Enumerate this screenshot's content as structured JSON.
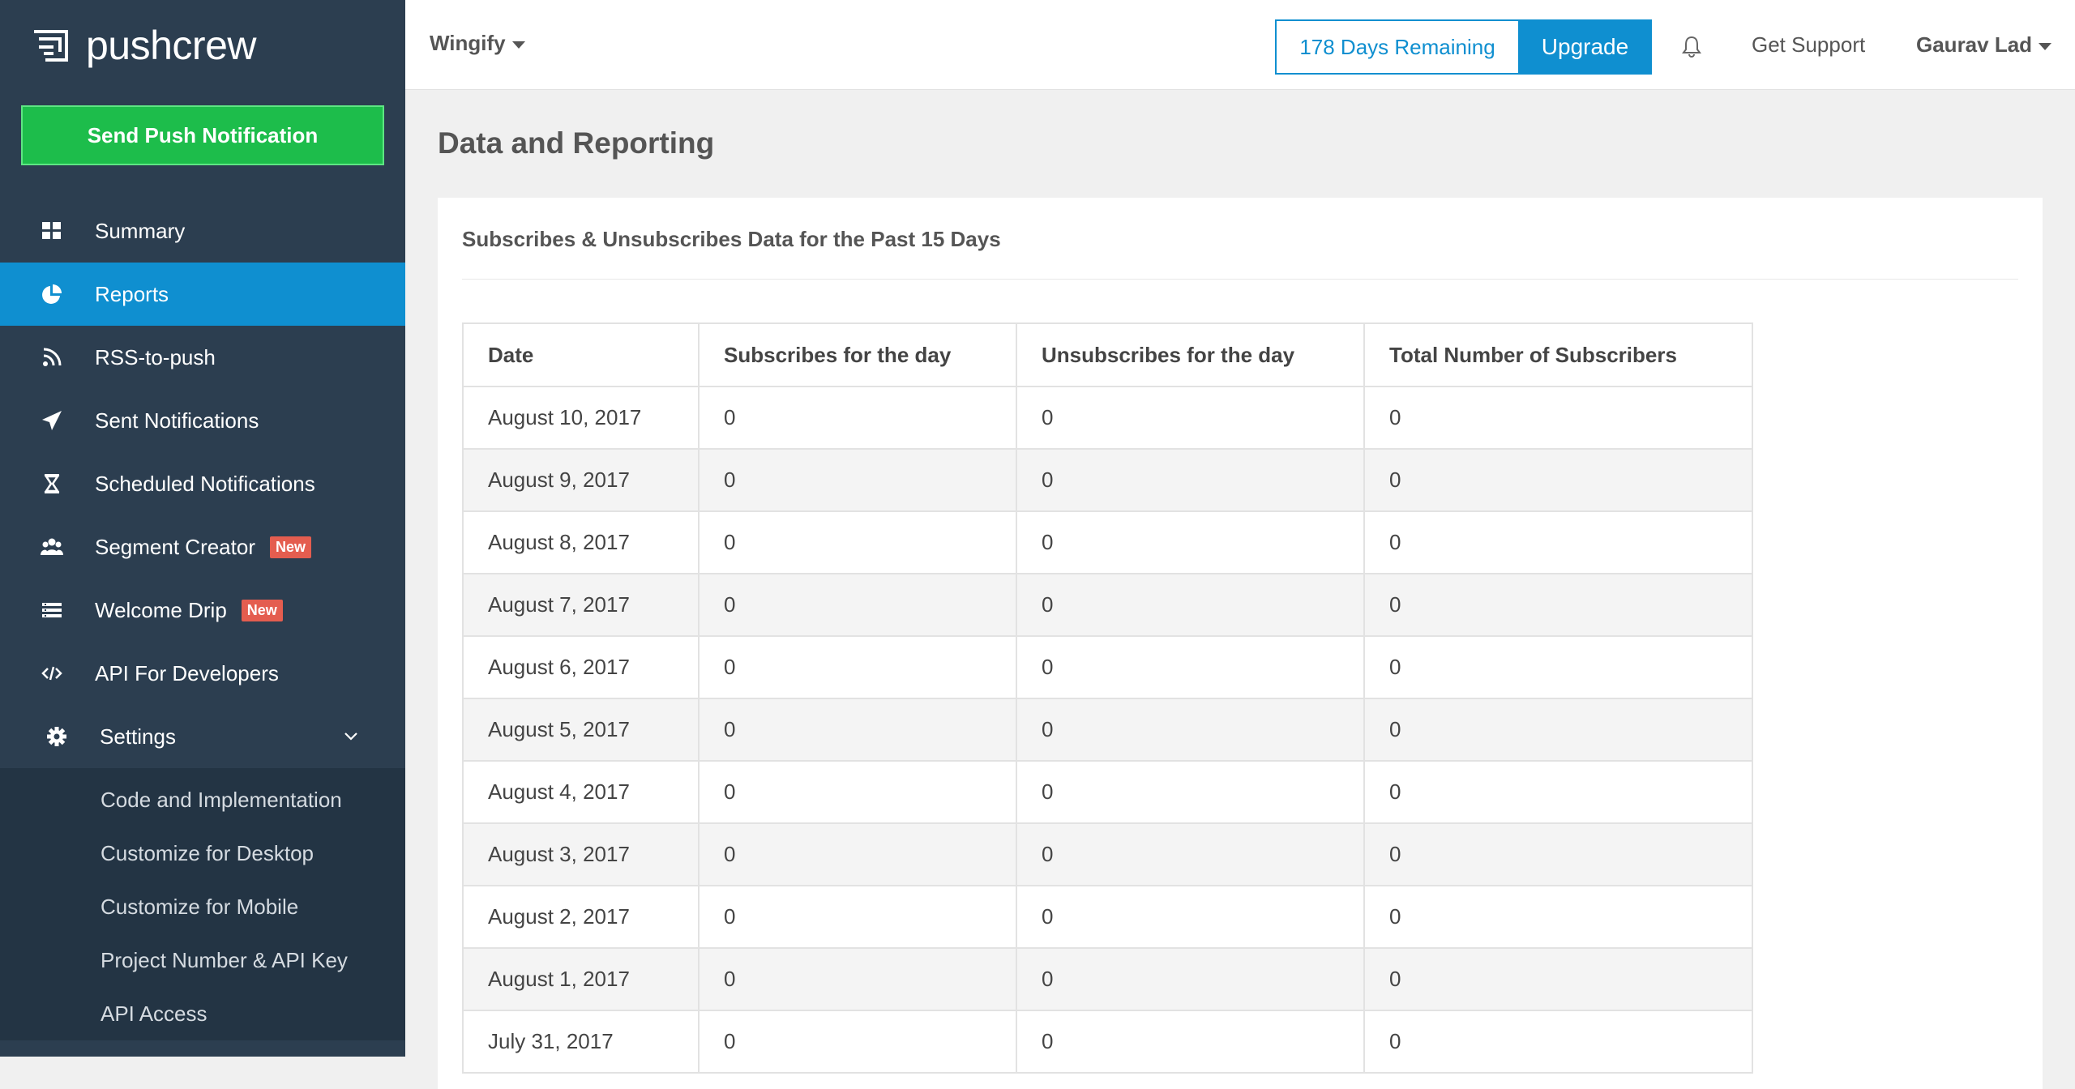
{
  "brand": {
    "name": "pushcrew"
  },
  "sidebar": {
    "send_button": "Send Push Notification",
    "items": [
      {
        "label": "Summary",
        "icon": "dashboard-icon",
        "active": false
      },
      {
        "label": "Reports",
        "icon": "pie-chart-icon",
        "active": true
      },
      {
        "label": "RSS-to-push",
        "icon": "rss-icon",
        "active": false
      },
      {
        "label": "Sent Notifications",
        "icon": "paper-plane-icon",
        "active": false
      },
      {
        "label": "Scheduled Notifications",
        "icon": "hourglass-icon",
        "active": false
      },
      {
        "label": "Segment Creator",
        "icon": "users-icon",
        "active": false,
        "badge": "New"
      },
      {
        "label": "Welcome Drip",
        "icon": "list-icon",
        "active": false,
        "badge": "New"
      },
      {
        "label": "API For Developers",
        "icon": "code-icon",
        "active": false
      },
      {
        "label": "Settings",
        "icon": "gear-icon",
        "active": false
      }
    ],
    "settings_subitems": [
      "Code and Implementation",
      "Customize for Desktop",
      "Customize for Mobile",
      "Project Number & API Key",
      "API Access"
    ]
  },
  "topbar": {
    "org": "Wingify",
    "days_remaining": "178 Days Remaining",
    "upgrade": "Upgrade",
    "support": "Get Support",
    "user": "Gaurav Lad"
  },
  "main": {
    "title": "Data and Reporting",
    "panel_title": "Subscribes & Unsubscribes Data for the Past 15 Days",
    "table": {
      "headers": [
        "Date",
        "Subscribes for the day",
        "Unsubscribes for the day",
        "Total Number of Subscribers"
      ],
      "rows": [
        [
          "August 10, 2017",
          "0",
          "0",
          "0"
        ],
        [
          "August 9, 2017",
          "0",
          "0",
          "0"
        ],
        [
          "August 8, 2017",
          "0",
          "0",
          "0"
        ],
        [
          "August 7, 2017",
          "0",
          "0",
          "0"
        ],
        [
          "August 6, 2017",
          "0",
          "0",
          "0"
        ],
        [
          "August 5, 2017",
          "0",
          "0",
          "0"
        ],
        [
          "August 4, 2017",
          "0",
          "0",
          "0"
        ],
        [
          "August 3, 2017",
          "0",
          "0",
          "0"
        ],
        [
          "August 2, 2017",
          "0",
          "0",
          "0"
        ],
        [
          "August 1, 2017",
          "0",
          "0",
          "0"
        ],
        [
          "July 31, 2017",
          "0",
          "0",
          "0"
        ]
      ]
    }
  },
  "colors": {
    "sidebar_bg": "#2c3e50",
    "active_item": "#0f8fd0",
    "send_button": "#1dbd4b",
    "badge": "#e45d4f",
    "accent": "#0f8fd0"
  }
}
